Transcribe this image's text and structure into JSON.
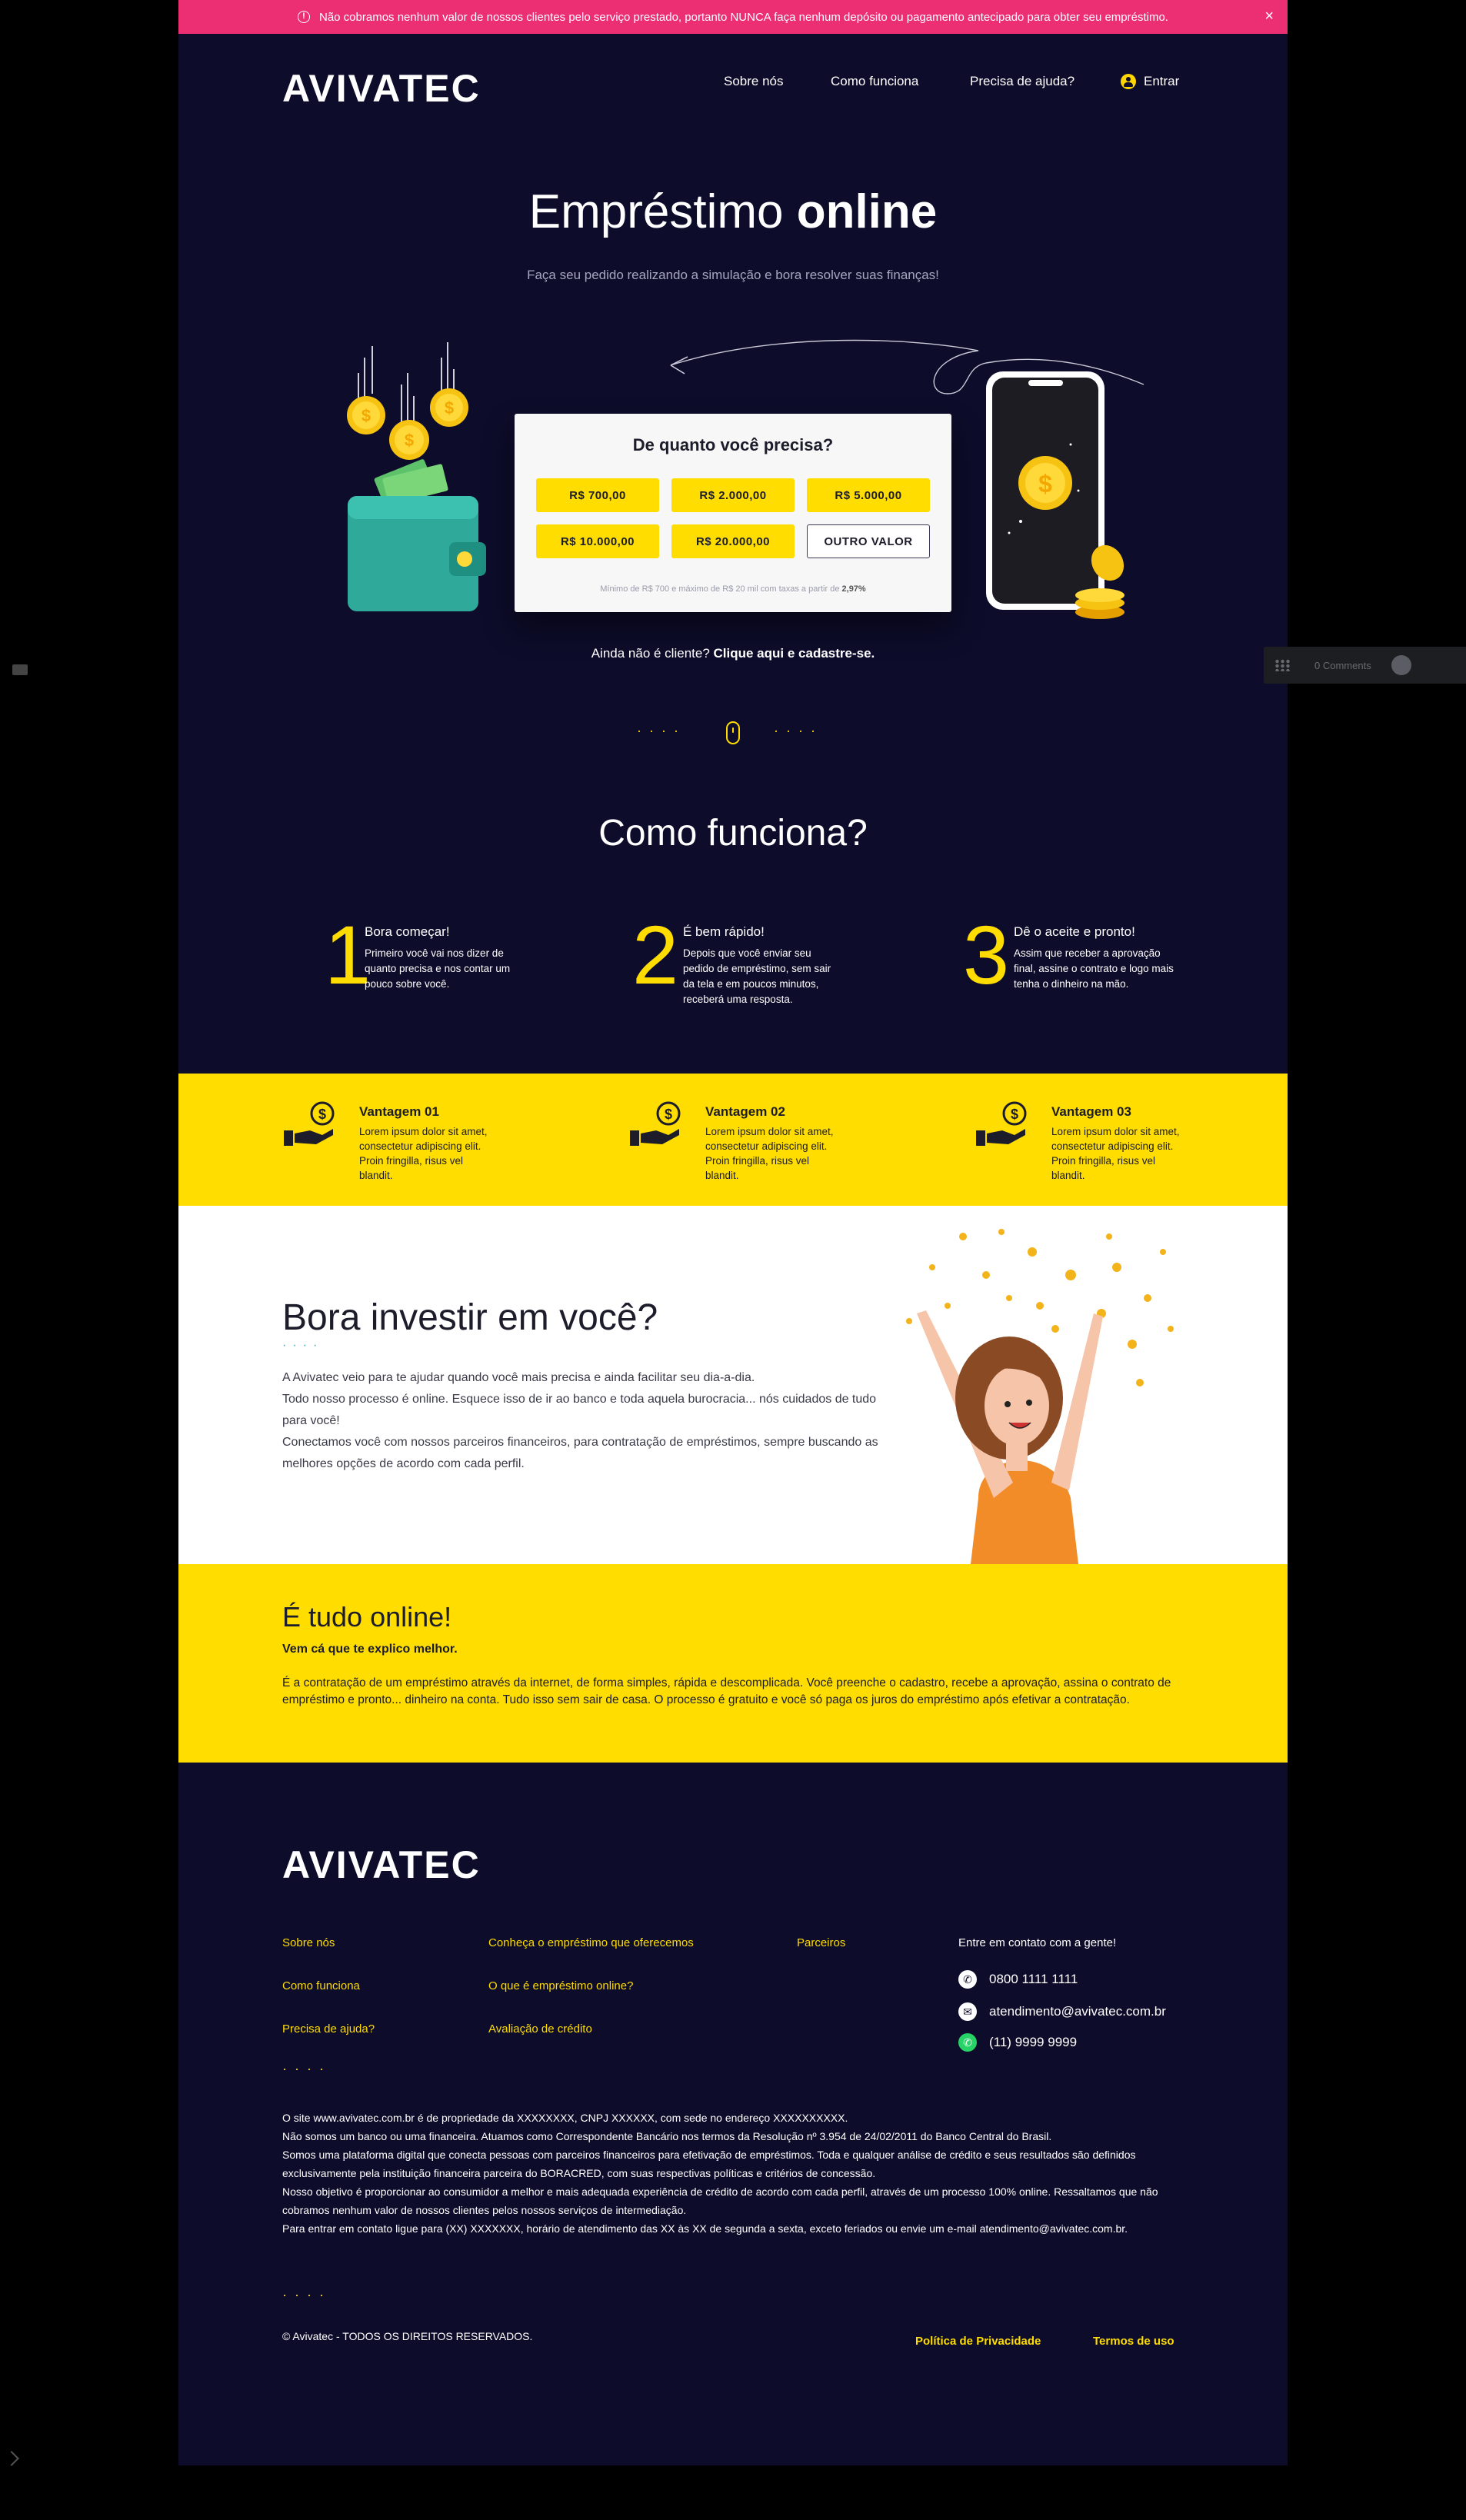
{
  "alert": {
    "text": "Não cobramos nenhum valor de nossos clientes pelo serviço prestado, portanto NUNCA faça nenhum depósito ou pagamento antecipado para obter seu empréstimo.",
    "warn_icon": "!",
    "close": "×"
  },
  "brand": {
    "logo": "AVIVATEC"
  },
  "nav": {
    "items": [
      "Sobre nós",
      "Como funciona",
      "Precisa de ajuda?"
    ],
    "login": "Entrar"
  },
  "hero": {
    "title_light": "Empréstimo ",
    "title_bold": "online",
    "subtitle": "Faça seu pedido realizando a simulação e bora resolver suas finanças!"
  },
  "calculator": {
    "title": "De quanto você precisa?",
    "options": [
      "R$ 700,00",
      "R$ 2.000,00",
      "R$ 5.000,00",
      "R$ 10.000,00",
      "R$ 20.000,00",
      "OUTRO VALOR"
    ],
    "note_prefix": "Mínimo de R$ 700 e máximo de R$ 20 mil com taxas a partir de ",
    "note_rate": "2,97%"
  },
  "signup": {
    "prefix": "Ainda não é cliente? ",
    "link": "Clique aqui e cadastre-se."
  },
  "how": {
    "title": "Como funciona?",
    "steps": [
      {
        "num": "1",
        "title": "Bora começar!",
        "desc": "Primeiro você vai nos dizer de quanto precisa e nos contar um pouco sobre você."
      },
      {
        "num": "2",
        "title": "É bem rápido!",
        "desc": "Depois que você enviar seu pedido de empréstimo, sem sair da tela e em poucos minutos, receberá uma resposta."
      },
      {
        "num": "3",
        "title": "Dê o aceite e pronto!",
        "desc": "Assim que receber a aprovação final, assine o contrato e logo mais tenha o dinheiro na mão."
      }
    ]
  },
  "advantages": [
    {
      "title": "Vantagem 01",
      "desc": "Lorem ipsum dolor sit amet, consectetur adipiscing elit. Proin fringilla, risus vel blandit."
    },
    {
      "title": "Vantagem 02",
      "desc": "Lorem ipsum dolor sit amet, consectetur adipiscing elit. Proin fringilla, risus vel blandit."
    },
    {
      "title": "Vantagem 03",
      "desc": "Lorem ipsum dolor sit amet, consectetur adipiscing elit. Proin fringilla, risus vel blandit."
    }
  ],
  "invest": {
    "title": "Bora investir em você?",
    "lines": [
      "A Avivatec veio para te ajudar quando você mais precisa e ainda facilitar seu dia-a-dia.",
      "Todo nosso processo é online. Esquece isso de ir ao banco e toda aquela burocracia... nós cuidados de tudo para você!",
      "Conectamos você com nossos parceiros financeiros, para contratação de empréstimos, sempre buscando as melhores opções de acordo com cada perfil."
    ]
  },
  "online": {
    "title": "É tudo online!",
    "subtitle": "Vem cá que te explico melhor.",
    "text": "É a contratação de um empréstimo através da internet, de forma simples, rápida e descomplicada. Você preenche o cadastro, recebe a aprovação, assina o contrato de empréstimo e pronto... dinheiro na conta. Tudo isso sem sair de casa. O processo é gratuito e você só paga os juros do empréstimo após efetivar a contratação."
  },
  "footer": {
    "links_col1": [
      "Sobre nós",
      "Como funciona",
      "Precisa de ajuda?"
    ],
    "links_col2": [
      "Conheça o empréstimo que oferecemos",
      "O que é empréstimo online?",
      "Avaliação de crédito"
    ],
    "links_col3": [
      "Parceiros"
    ],
    "contact_title": "Entre em contato com a gente!",
    "phone": "0800 1111 1111",
    "email": "atendimento@avivatec.com.br",
    "whatsapp": "(11) 9999 9999",
    "legal": [
      "O site www.avivatec.com.br é de propriedade da XXXXXXXX, CNPJ XXXXXX, com sede no endereço XXXXXXXXXX.",
      "Não somos um banco ou uma financeira. Atuamos como Correspondente Bancário nos termos da Resolução nº 3.954 de 24/02/2011 do Banco Central do Brasil.",
      "Somos uma plataforma digital que conecta pessoas com parceiros financeiros para efetivação de empréstimos. Toda e qualquer análise de crédito e seus resultados são definidos exclusivamente pela instituição financeira parceira do BORACRED, com suas respectivas políticas e critérios de concessão.",
      "Nosso objetivo é proporcionar ao consumidor a melhor e mais adequada experiência de crédito de acordo com cada perfil, através de um processo 100% online. Ressaltamos que não cobramos nenhum valor de nossos clientes pelos nossos serviços de intermediação.",
      "Para entrar em contato ligue para (XX) XXXXXXX, horário de atendimento das XX às XX de segunda a sexta, exceto feriados ou envie um e-mail atendimento@avivatec.com.br."
    ],
    "copyright": "© Avivatec - TODOS OS DIREITOS RESERVADOS.",
    "privacy": "Política de Privacidade",
    "terms": "Termos de uso"
  },
  "widget": {
    "comments": "0 Comments"
  },
  "colors": {
    "navy": "#0d0c2a",
    "yellow": "#ffdd00",
    "pink": "#ec2e73",
    "teal": "#2cb4c4"
  }
}
